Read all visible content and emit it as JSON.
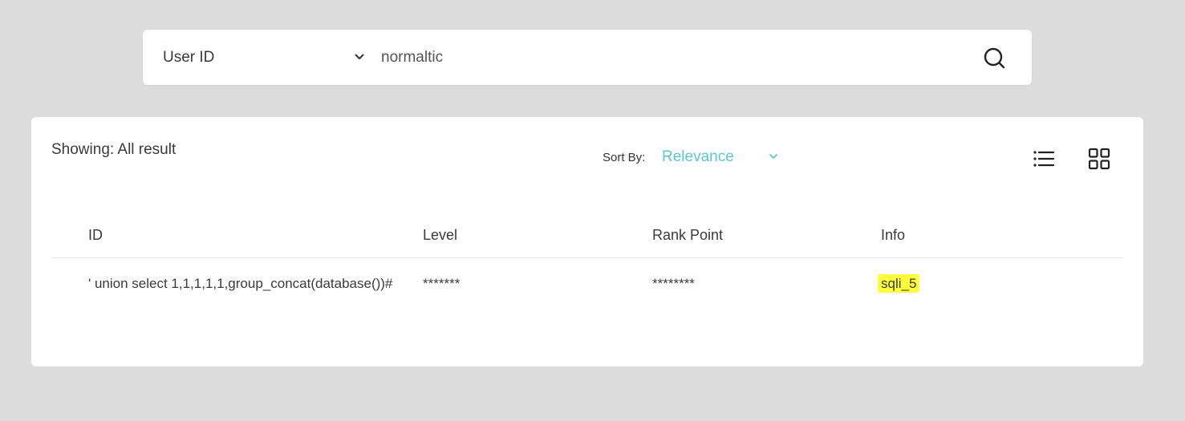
{
  "search": {
    "field_selected": "User ID",
    "query_value": "normaltic",
    "search_icon": "search-icon",
    "field_chevron_icon": "chevron-down-icon"
  },
  "results": {
    "showing_text": "Showing: All result",
    "sort_label": "Sort By:",
    "sort_selected": "Relevance",
    "sort_chevron_icon": "chevron-down-icon",
    "view_list_icon": "list-view-icon",
    "view_grid_icon": "grid-view-icon",
    "columns": [
      "ID",
      "Level",
      "Rank Point",
      "Info"
    ],
    "rows": [
      {
        "id": "' union select 1,1,1,1,1,group_concat(database())#",
        "level": "*******",
        "rank_point": "********",
        "info": "sqli_5"
      }
    ]
  },
  "colors": {
    "background": "#dcdcdc",
    "card": "#ffffff",
    "accent": "#5cc6cc",
    "highlight": "#ffff3c"
  }
}
